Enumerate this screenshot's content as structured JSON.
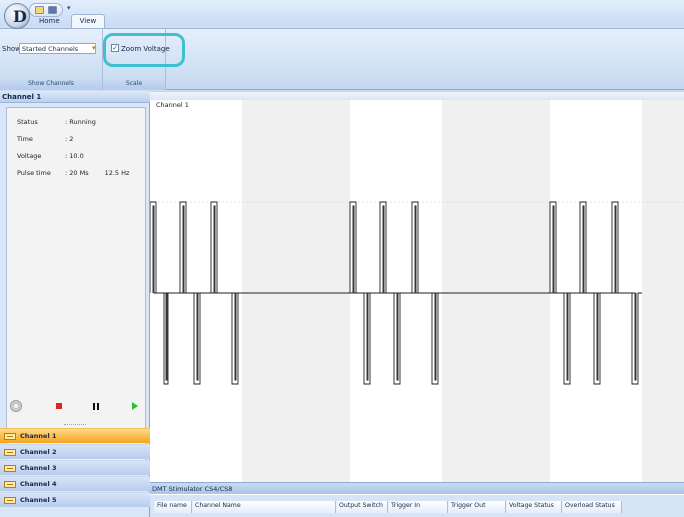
{
  "app": {
    "logo_letter": "D",
    "qat_dropdown": "▾"
  },
  "tabs": [
    {
      "label": "Home",
      "active": false
    },
    {
      "label": "View",
      "active": true
    }
  ],
  "ribbon": {
    "show_label": "Show",
    "show_select_value": "Started Channels",
    "show_group_label": "Show Channels",
    "zoom_voltage_label": "Zoom Voltage",
    "zoom_voltage_checked": true,
    "scale_group_label": "Scale"
  },
  "left_panel": {
    "header": "Channel 1",
    "info": {
      "status_label": "Status",
      "status_value": ": Running",
      "time_label": "Time",
      "time_value": ": 2",
      "voltage_label": "Voltage",
      "voltage_value": ": 10.0",
      "pulse_label": "Pulse time",
      "pulse_value": ": 20 Ms",
      "pulse_freq": "12.5 Hz"
    },
    "channels": [
      {
        "label": "Channel 1",
        "active": true
      },
      {
        "label": "Channel 2",
        "active": false
      },
      {
        "label": "Channel 3",
        "active": false
      },
      {
        "label": "Channel 4",
        "active": false
      },
      {
        "label": "Channel 5",
        "active": false
      }
    ]
  },
  "plot": {
    "title": "Channel 1"
  },
  "bottom_panel": {
    "title": "DMT Stimulator CS4/CS8",
    "columns": [
      "File name",
      "Channel Name",
      "Output Switch",
      "Trigger In",
      "Trigger Out",
      "Voltage Status",
      "Overload Status"
    ]
  },
  "colors": {
    "accent_highlight": "#3ec1cf",
    "active_channel": "#f6a31b",
    "stop": "#e02424",
    "play": "#2bbf3a"
  }
}
